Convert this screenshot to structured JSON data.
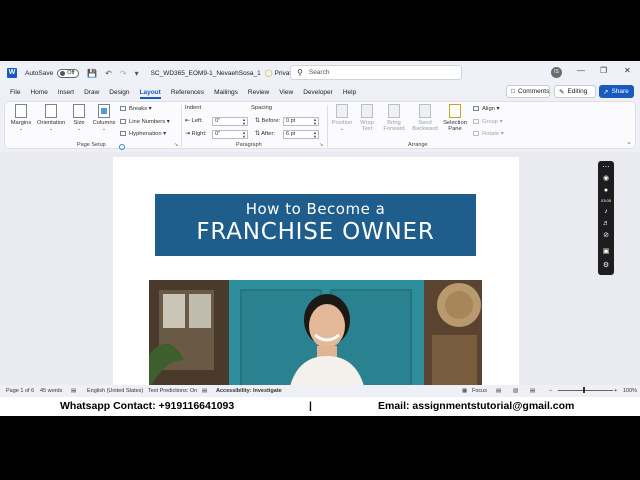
{
  "titlebar": {
    "autosave_label": "AutoSave",
    "autosave_state": "Off",
    "filename": "SC_WD365_EOM9-1_NevaehSosa_1",
    "privacy": "Private",
    "privacy_suffix": "•",
    "search_placeholder": "Search",
    "avatar_initials": "IS"
  },
  "menu": {
    "tabs": [
      "File",
      "Home",
      "Insert",
      "Draw",
      "Design",
      "Layout",
      "References",
      "Mailings",
      "Review",
      "View",
      "Developer",
      "Help"
    ],
    "active": "Layout",
    "comments_label": "Comments",
    "editing_label": "Editing",
    "share_label": "Share"
  },
  "ribbon": {
    "page_setup": {
      "margins": "Margins",
      "orientation": "Orientation",
      "size": "Size",
      "columns": "Columns",
      "breaks": "Breaks",
      "line_numbers": "Line Numbers",
      "hyphenation": "Hyphenation",
      "group_label": "Page Setup"
    },
    "paragraph": {
      "indent_label": "Indent",
      "spacing_label": "Spacing",
      "left_label": "Left:",
      "right_label": "Right:",
      "before_label": "Before:",
      "after_label": "After:",
      "left_value": "0\"",
      "right_value": "0\"",
      "before_value": "0 pt",
      "after_value": "6 pt",
      "group_label": "Paragraph"
    },
    "arrange": {
      "position": "Position",
      "wrap_text_1": "Wrap",
      "wrap_text_2": "Text",
      "bring_forward_1": "Bring",
      "bring_forward_2": "Forward",
      "send_backward_1": "Send",
      "send_backward_2": "Backward",
      "selection_pane_1": "Selection",
      "selection_pane_2": "Pane",
      "align": "Align",
      "group": "Group",
      "rotate": "Rotate",
      "group_label": "Arrange"
    }
  },
  "document": {
    "banner_line1": "How to Become a",
    "banner_line2": "FRANCHISE OWNER"
  },
  "recorder": {
    "timer": "03:05"
  },
  "status": {
    "page": "Page 1 of 6",
    "words": "45 words",
    "language": "English (United States)",
    "text_predictions": "Text Predictions: On",
    "accessibility": "Accessibility: Investigate",
    "focus": "Focus",
    "zoom": "100%"
  },
  "footer": {
    "whatsapp": "Whatsapp Contact: +919116641093",
    "divider": "|",
    "email": "Email: assignmentstutorial@gmail.com"
  }
}
